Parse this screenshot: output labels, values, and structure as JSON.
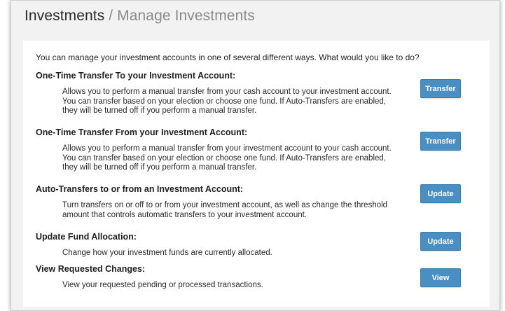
{
  "header": {
    "title": "Investments",
    "separator": " / ",
    "subtitle": "Manage Investments"
  },
  "intro": "You can manage your investment accounts in one of several different ways. What would you like to do?",
  "options": [
    {
      "heading": "One-Time Transfer To your Investment Account:",
      "description": "Allows you to perform a manual transfer from your cash account to your investment account. You can transfer based on your election or choose one fund. If Auto-Transfers are enabled, they will be turned off if you perform a manual transfer.",
      "button": "Transfer"
    },
    {
      "heading": "One-Time Transfer From your Investment Account:",
      "description": "Allows you to perform a manual transfer from your investment account to your cash account. You can transfer based on your election or choose one fund. If Auto-Transfers are enabled, they will be turned off if you perform a manual transfer.",
      "button": "Transfer"
    },
    {
      "heading": "Auto-Transfers to or from an Investment Account:",
      "description": "Turn transfers on or off to or from your investment account, as well as change the threshold amount that controls automatic transfers to your investment account.",
      "button": "Update"
    },
    {
      "heading": "Update Fund Allocation:",
      "description": "Change how your investment funds are currently allocated.",
      "button": "Update"
    },
    {
      "heading": "View Requested Changes:",
      "description": "View your requested pending or processed transactions.",
      "button": "View"
    }
  ],
  "colors": {
    "button": "#4a8fc4",
    "panel": "#f2f2f2",
    "title": "#2b2b2b",
    "subtitle": "#8a8a8a"
  }
}
